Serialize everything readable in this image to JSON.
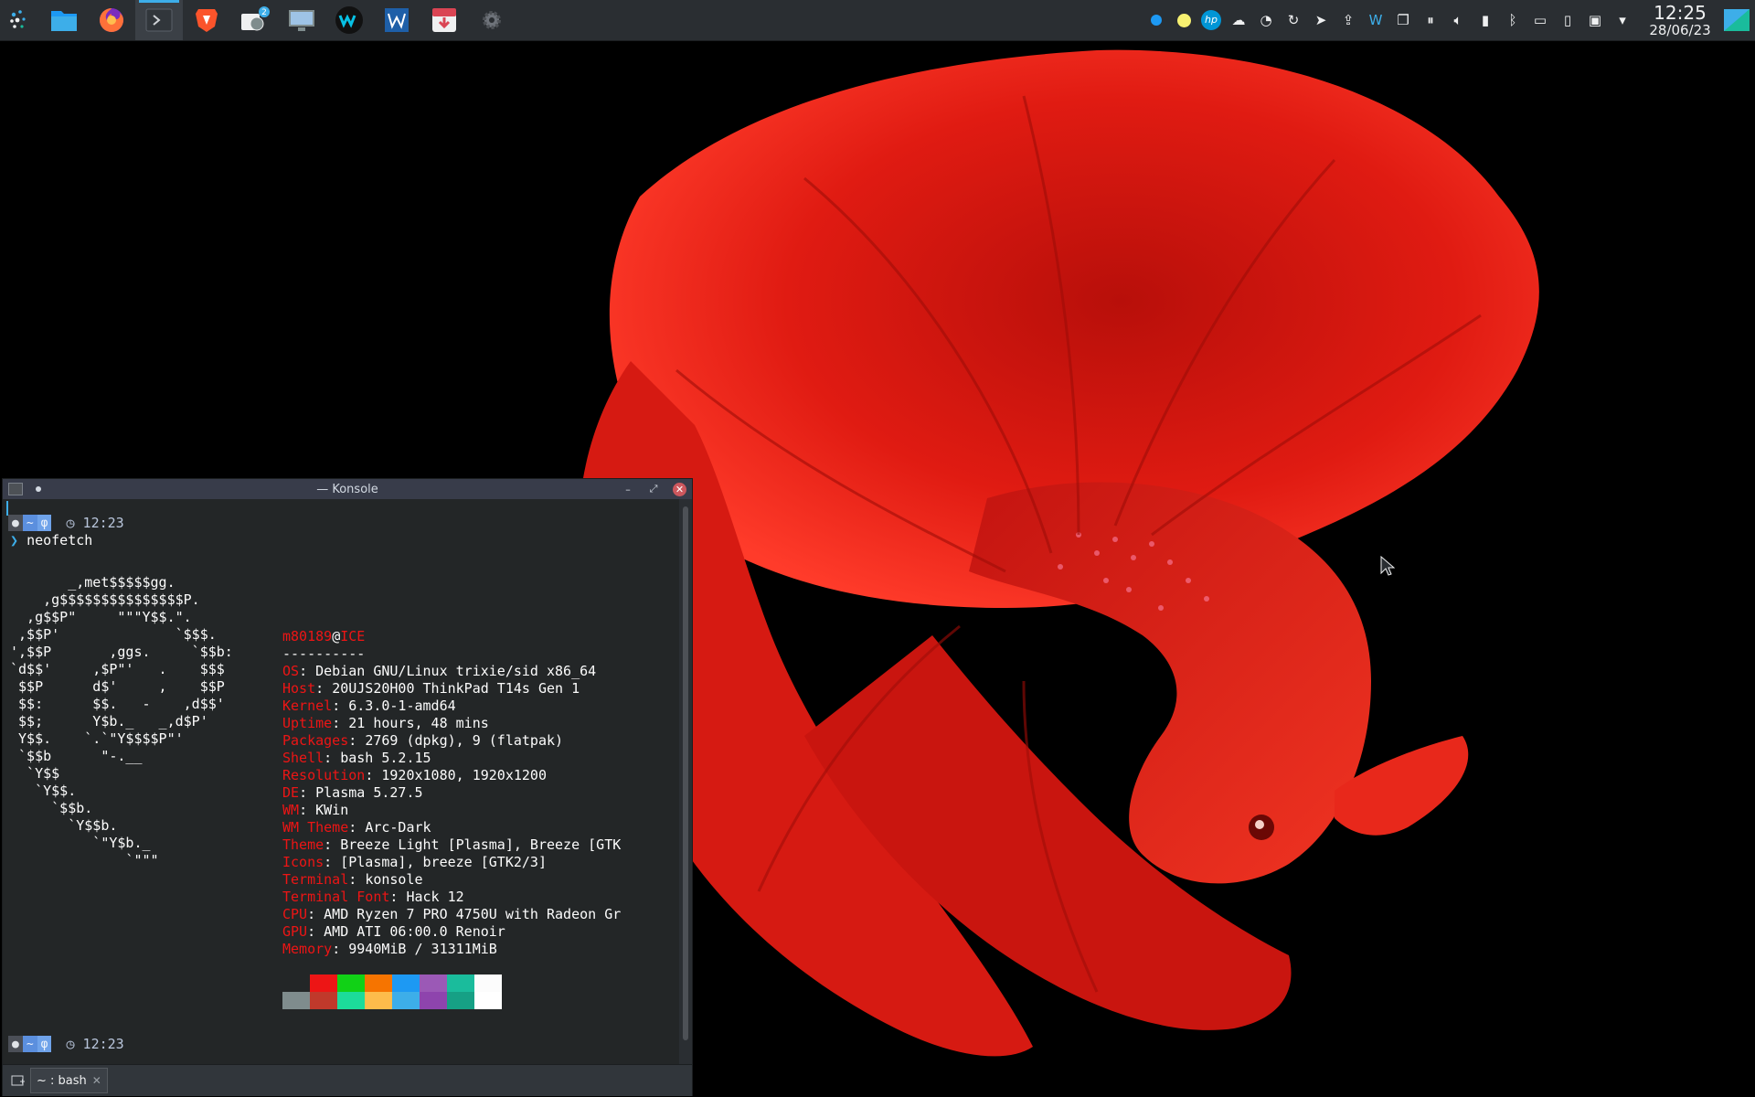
{
  "panel": {
    "launcher_icon": "kde-application-launcher-icon",
    "tasks": [
      {
        "name": "file-manager",
        "icon": "folder-icon"
      },
      {
        "name": "firefox",
        "icon": "firefox-icon"
      },
      {
        "name": "konsole",
        "icon": "terminal-icon",
        "active": true
      },
      {
        "name": "brave",
        "icon": "brave-lion-icon"
      },
      {
        "name": "kalarm",
        "icon": "alarm-clock-icon",
        "badge": "2"
      },
      {
        "name": "remote-desktop",
        "icon": "remote-desktop-icon"
      },
      {
        "name": "webex",
        "icon": "webex-icon"
      },
      {
        "name": "libreoffice-writer",
        "icon": "document-writer-icon"
      },
      {
        "name": "pocket-downloader",
        "icon": "download-tray-icon"
      },
      {
        "name": "settings",
        "icon": "gear-icon"
      }
    ],
    "tray_icons": [
      "info-icon",
      "yellow-status-icon",
      "hp-icon",
      "cloud-icon",
      "clock-history-icon",
      "refresh-icon",
      "telegram-icon",
      "upload-icon",
      "webex-tray-icon",
      "clipboard-icon",
      "media-pause-icon",
      "volume-icon",
      "battery-icon",
      "bluetooth-icon",
      "display-icon",
      "phone-icon",
      "screen-icon",
      "expand-tray-icon"
    ],
    "clock": {
      "time": "12:25",
      "date": "28/06/23"
    }
  },
  "konsole": {
    "title": "— Konsole",
    "prompt_path": "~",
    "prompt_time": "12:23",
    "command": "neofetch",
    "tab_label": "~ : bash",
    "ascii_art": [
      "       _,met$$$$$gg.",
      "    ,g$$$$$$$$$$$$$$$P.",
      "  ,g$$P\"     \"\"\"Y$$.\".",
      " ,$$P'              `$$$.",
      "',$$P       ,ggs.     `$$b:",
      "`d$$'     ,$P\"'   .    $$$",
      " $$P      d$'     ,    $$P",
      " $$:      $$.   -    ,d$$'",
      " $$;      Y$b._   _,d$P'",
      " Y$$.    `.`\"Y$$$$P\"'",
      " `$$b      \"-.__",
      "  `Y$$",
      "   `Y$$.",
      "     `$$b.",
      "       `Y$$b.",
      "          `\"Y$b._",
      "              `\"\"\""
    ],
    "user": "m80189",
    "host": "ICE",
    "separator": "----------",
    "info": [
      {
        "key": "OS",
        "value": "Debian GNU/Linux trixie/sid x86_64"
      },
      {
        "key": "Host",
        "value": "20UJS20H00 ThinkPad T14s Gen 1"
      },
      {
        "key": "Kernel",
        "value": "6.3.0-1-amd64"
      },
      {
        "key": "Uptime",
        "value": "21 hours, 48 mins"
      },
      {
        "key": "Packages",
        "value": "2769 (dpkg), 9 (flatpak)"
      },
      {
        "key": "Shell",
        "value": "bash 5.2.15"
      },
      {
        "key": "Resolution",
        "value": "1920x1080, 1920x1200"
      },
      {
        "key": "DE",
        "value": "Plasma 5.27.5"
      },
      {
        "key": "WM",
        "value": "KWin"
      },
      {
        "key": "WM Theme",
        "value": "Arc-Dark"
      },
      {
        "key": "Theme",
        "value": "Breeze Light [Plasma], Breeze [GTK"
      },
      {
        "key": "Icons",
        "value": "[Plasma], breeze [GTK2/3]"
      },
      {
        "key": "Terminal",
        "value": "konsole"
      },
      {
        "key": "Terminal Font",
        "value": "Hack 12"
      },
      {
        "key": "CPU",
        "value": "AMD Ryzen 7 PRO 4750U with Radeon Gr"
      },
      {
        "key": "GPU",
        "value": "AMD ATI 06:00.0 Renoir"
      },
      {
        "key": "Memory",
        "value": "9940MiB / 31311MiB"
      }
    ],
    "palette_top": [
      "#232627",
      "#ed1515",
      "#11d116",
      "#f67400",
      "#1d99f3",
      "#9b59b6",
      "#1abc9c",
      "#fcfcfc"
    ],
    "palette_bottom": [
      "#7f8c8d",
      "#c0392b",
      "#1cdc9a",
      "#fdbc4b",
      "#3daee9",
      "#8e44ad",
      "#16a085",
      "#ffffff"
    ]
  },
  "colors": {
    "accent": "#3daee9",
    "neofetch_key": "#ed1515",
    "fish_red": "#e01b12"
  }
}
